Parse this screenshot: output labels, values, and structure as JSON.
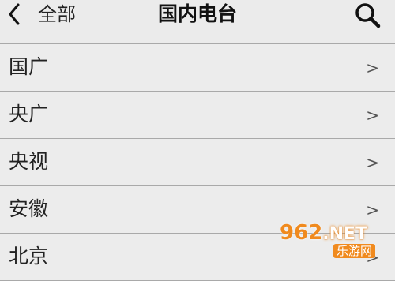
{
  "header": {
    "back_label": "全部",
    "title": "国内电台",
    "back_icon": "chevron-left-icon",
    "search_icon": "search-icon"
  },
  "list": {
    "items": [
      {
        "label": "国广",
        "chevron": ">"
      },
      {
        "label": "央广",
        "chevron": ">"
      },
      {
        "label": "央视",
        "chevron": ">"
      },
      {
        "label": "安徽",
        "chevron": ">"
      },
      {
        "label": "北京",
        "chevron": ">"
      }
    ]
  },
  "watermark": {
    "brand_number": "962",
    "brand_domain": ".NET",
    "brand_name": "乐游网"
  },
  "colors": {
    "background": "#ececec",
    "divider": "#a9a9a9",
    "text": "#222222",
    "watermark_orange": "#f08a1e"
  }
}
